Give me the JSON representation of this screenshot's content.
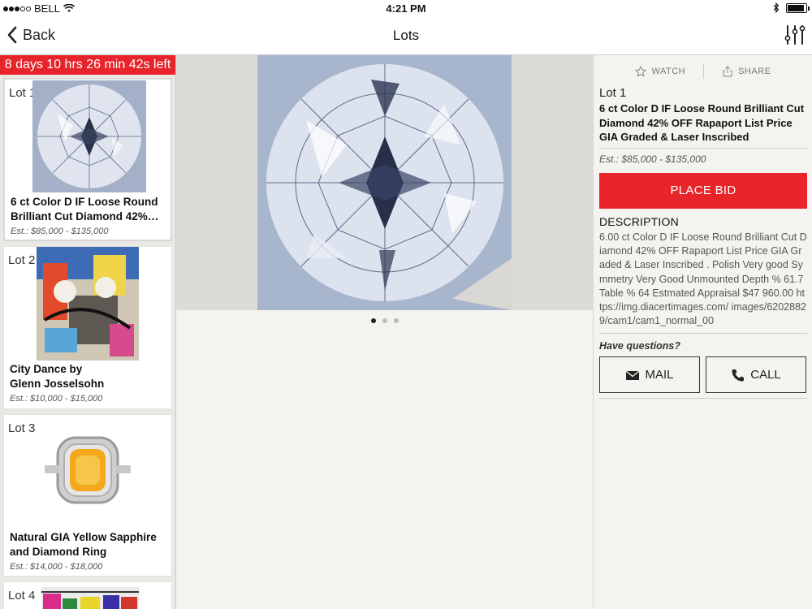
{
  "status_bar": {
    "carrier": "BELL",
    "time": "4:21 PM",
    "battery_level": 0.9
  },
  "nav": {
    "back_label": "Back",
    "title": "Lots"
  },
  "sidebar": {
    "countdown": "8 days 10 hrs 26 min 42s left",
    "lots": [
      {
        "lot": "Lot 1",
        "title": "6 ct Color D IF Loose Round Brilliant Cut Diamond  42%…",
        "estimate": "Est.: $85,000 - $135,000"
      },
      {
        "lot": "Lot 2",
        "title": "City Dance by\nGlenn Josselsohn",
        "estimate": "Est.: $10,000 - $15,000"
      },
      {
        "lot": "Lot 3",
        "title": "Natural GIA  Yellow Sapphire and Diamond Ring",
        "estimate": "Est.: $14,000 - $18,000"
      },
      {
        "lot": "Lot 4",
        "title": "",
        "estimate": ""
      }
    ]
  },
  "detail": {
    "watch_label": "WATCH",
    "share_label": "SHARE",
    "lot_label": "Lot 1",
    "title": "6 ct Color D IF Loose Round Brilliant Cut Diamond  42% OFF Rapaport List Price GIA Graded  & Laser Inscribed",
    "estimate": "Est.: $85,000 - $135,000",
    "place_bid_label": "PLACE BID",
    "description_heading": "DESCRIPTION",
    "description": "6.00 ct Color D IF Loose Round Brilliant Cut Diamond 42% OFF Rapaport List Price GIA Graded & Laser Inscribed . Polish Very good Symmetry Very Good Unmounted Depth % 61.7 Table % 64 Estmated Appraisal $47 960.00 https://img.diacertimages.com/ images/62028829/cam1/cam1_normal_00",
    "questions_label": "Have questions?",
    "mail_label": "MAIL",
    "call_label": "CALL"
  },
  "gallery": {
    "page_count": 3,
    "active_page": 1
  },
  "colors": {
    "accent": "#e8242b",
    "background": "#f4f3ef"
  }
}
